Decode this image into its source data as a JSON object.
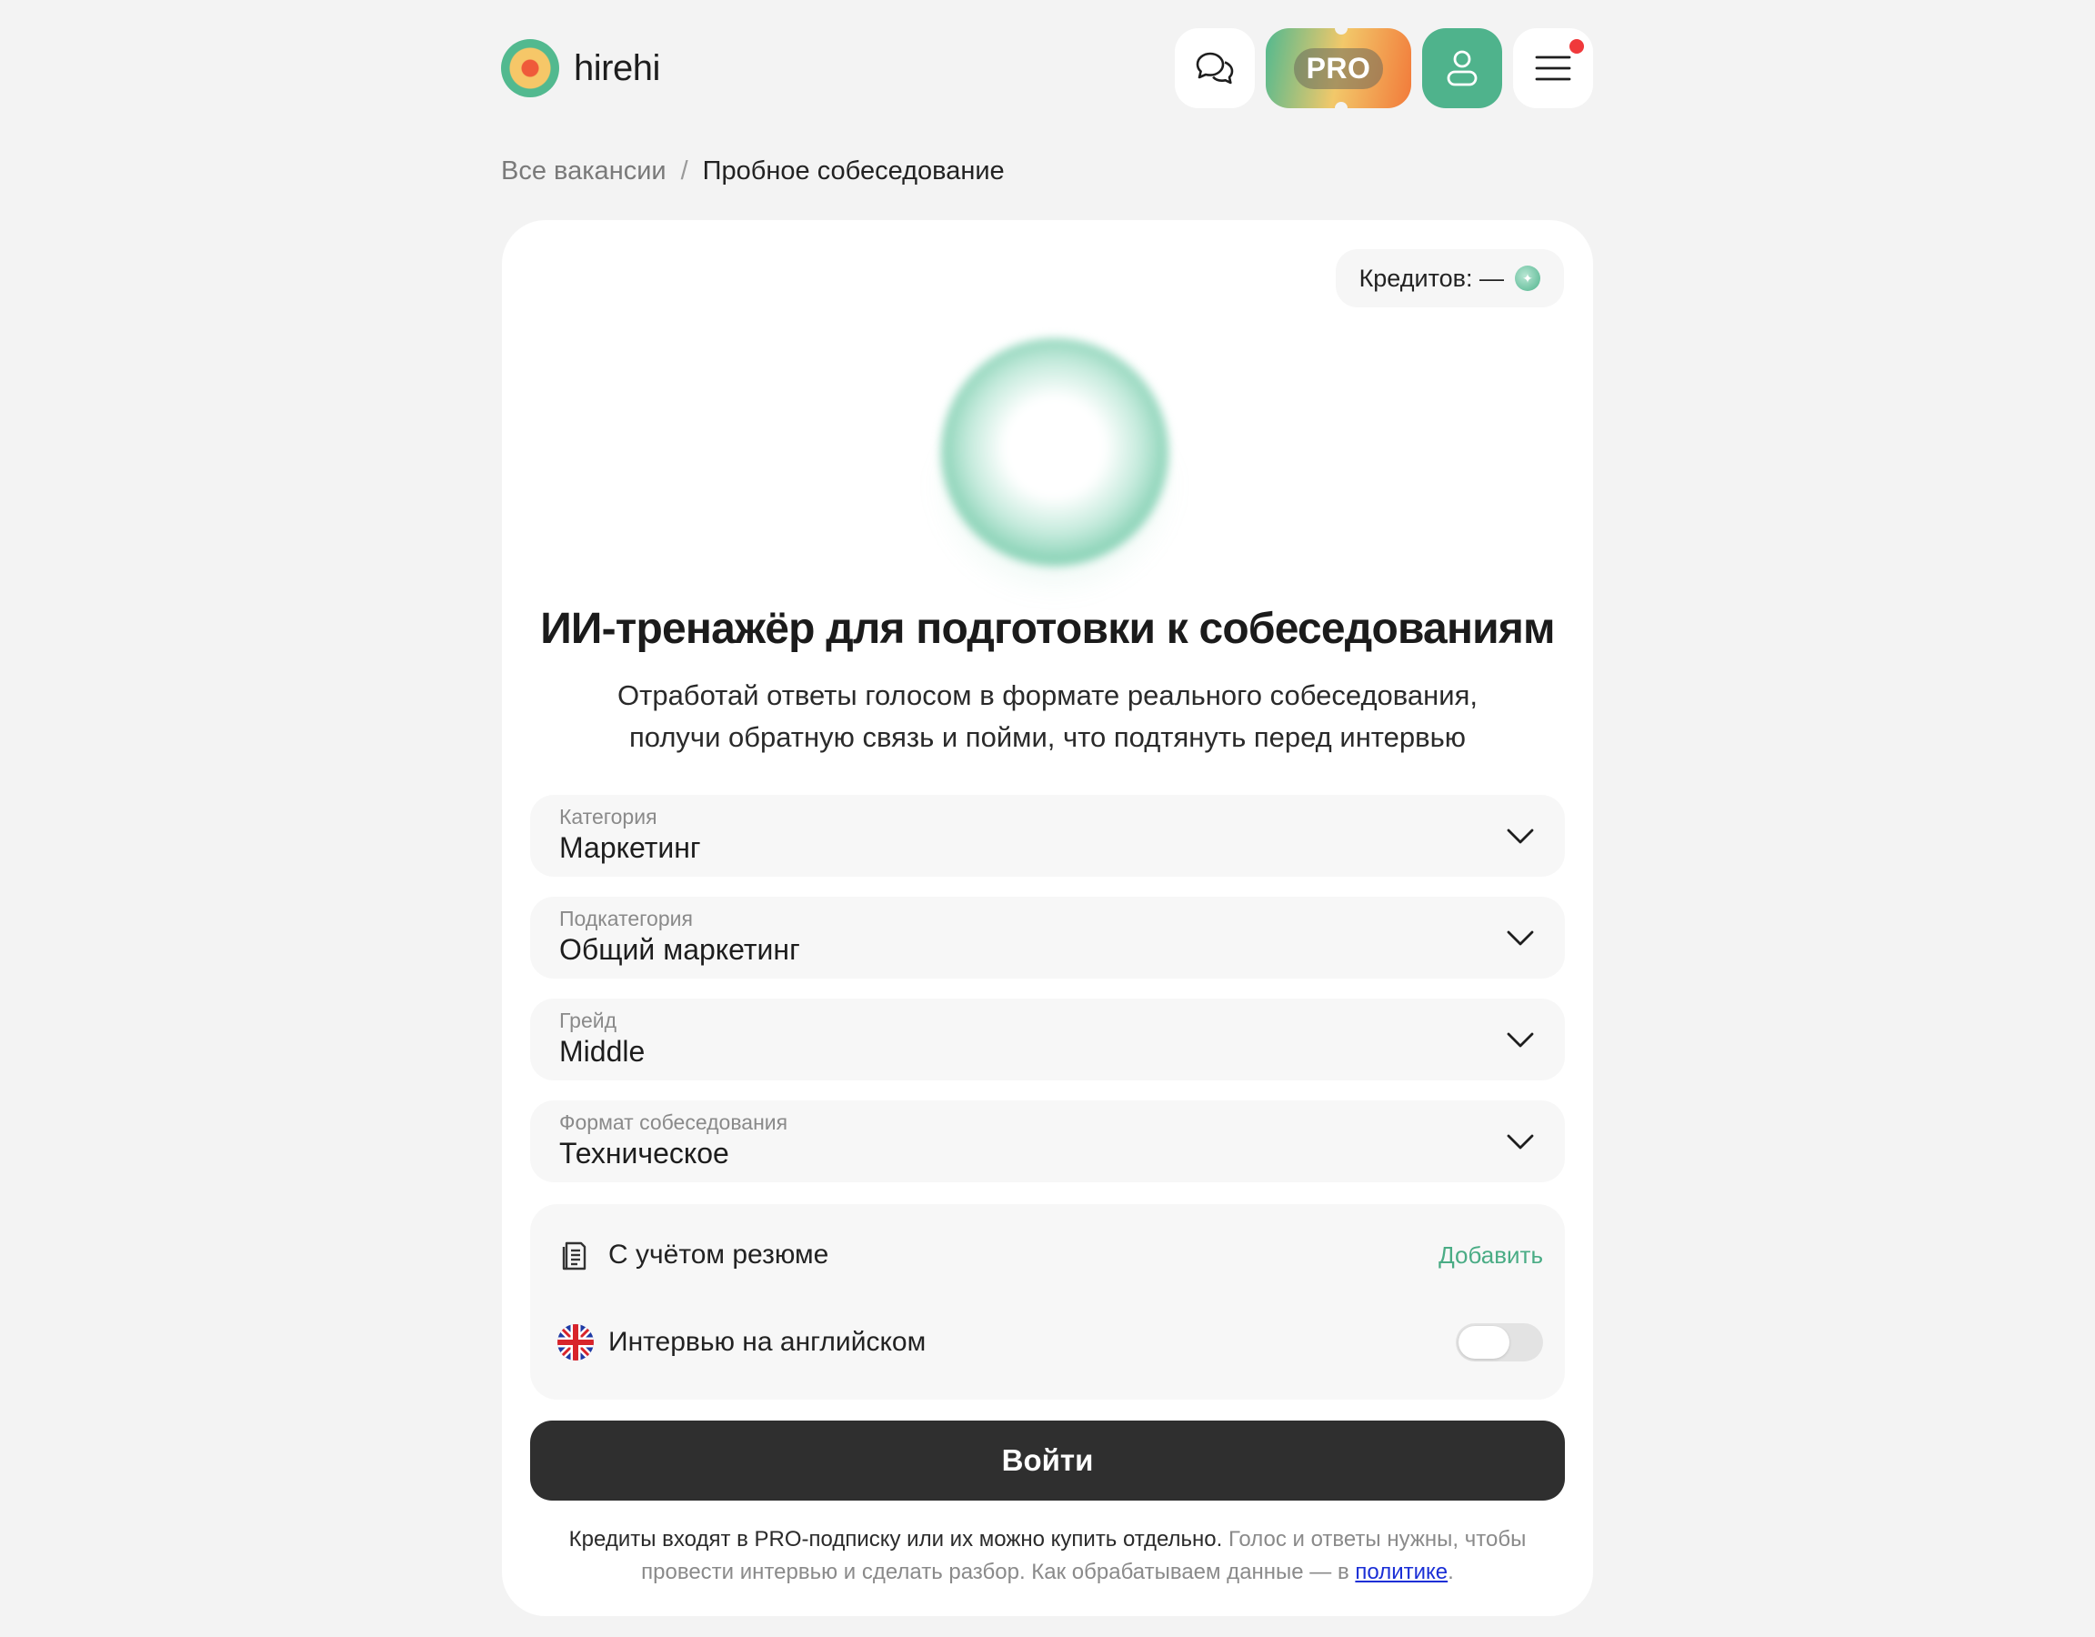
{
  "header": {
    "logo_text": "hirehi",
    "pro_label": "PRO",
    "brand_colors": {
      "green": "#4fb38c",
      "yellow": "#f2c86a",
      "orange": "#f27a3a",
      "notification": "#f0393b"
    },
    "icons": [
      "chat-icon",
      "user-icon",
      "menu-icon"
    ]
  },
  "breadcrumb": {
    "link": "Все вакансии",
    "separator": "/",
    "current": "Пробное собеседование"
  },
  "credits": {
    "label": "Кредитов: —"
  },
  "hero": {
    "title": "ИИ-тренажёр для подготовки к собеседованиям",
    "subtitle_line1": "Отработай ответы голосом в формате реального собеседования,",
    "subtitle_line2": "получи обратную связь и пойми, что подтянуть перед интервью"
  },
  "selects": [
    {
      "label": "Категория",
      "value": "Маркетинг"
    },
    {
      "label": "Подкатегория",
      "value": "Общий маркетинг"
    },
    {
      "label": "Грейд",
      "value": "Middle"
    },
    {
      "label": "Формат собеседования",
      "value": "Техническое"
    }
  ],
  "options": {
    "resume_label": "С учётом резюме",
    "resume_action": "Добавить",
    "english_label": "Интервью на английском",
    "english_enabled": false
  },
  "login_button": "Войти",
  "footnote": {
    "strong": "Кредиты входят в PRO-подписку или их можно купить отдельно.",
    "rest": " Голос и ответы нужны, чтобы провести интервью и сделать разбор. Как обрабатываем данные — в ",
    "link": "политике",
    "end": "."
  }
}
